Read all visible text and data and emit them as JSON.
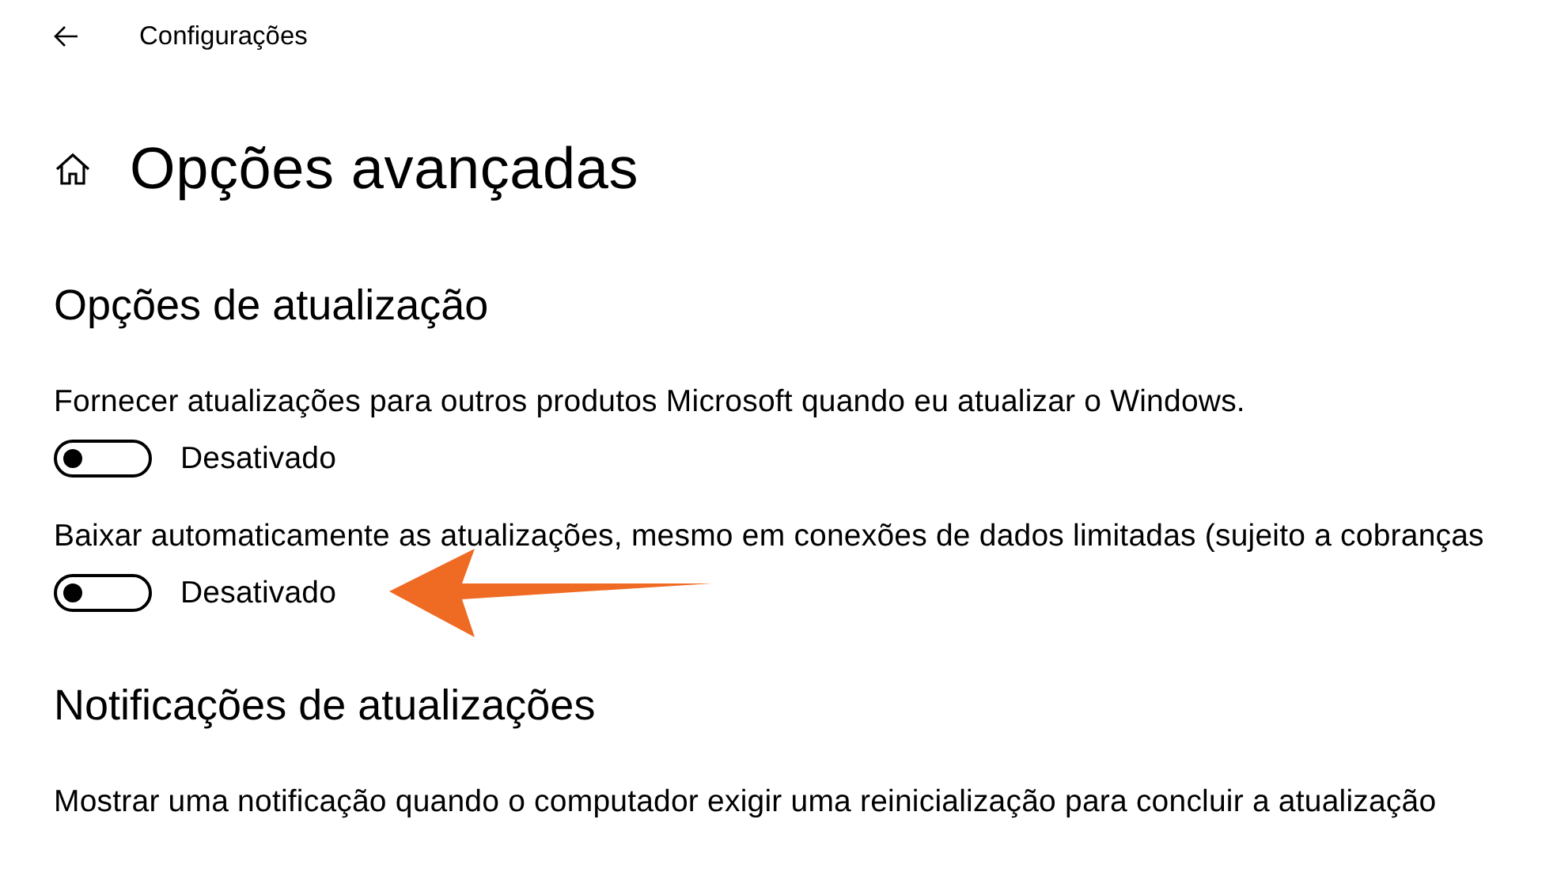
{
  "window": {
    "title": "Configurações"
  },
  "page": {
    "title": "Opções avançadas"
  },
  "sections": [
    {
      "heading": "Opções de atualização",
      "settings": [
        {
          "label": "Fornecer atualizações para outros produtos Microsoft quando eu atualizar o Windows.",
          "on": false,
          "state_text": "Desativado",
          "annotated": false
        },
        {
          "label": "Baixar automaticamente as atualizações, mesmo em conexões de dados limitadas (sujeito a cobranças",
          "on": false,
          "state_text": "Desativado",
          "annotated": true
        }
      ]
    },
    {
      "heading": "Notificações de atualizações",
      "settings": [
        {
          "label": "Mostrar uma notificação quando o computador exigir uma reinicialização para concluir a atualização"
        }
      ]
    }
  ]
}
